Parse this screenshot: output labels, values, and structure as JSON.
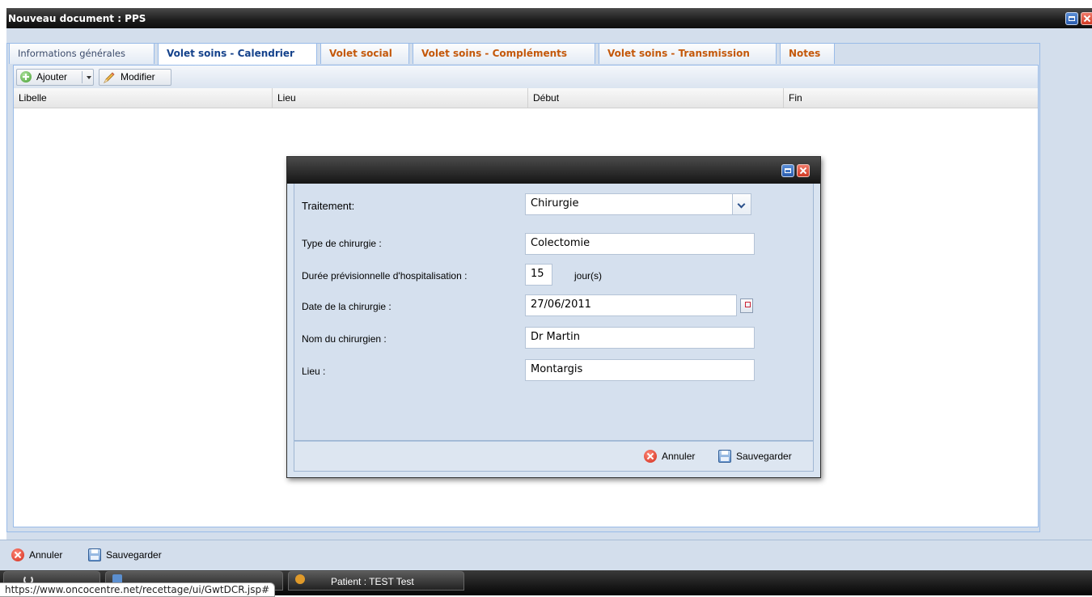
{
  "window": {
    "title": "Nouveau document : PPS"
  },
  "tabs": [
    {
      "label": "Informations générales"
    },
    {
      "label": "Volet soins - Calendrier"
    },
    {
      "label": "Volet social"
    },
    {
      "label": "Volet soins - Compléments"
    },
    {
      "label": "Volet soins - Transmission"
    },
    {
      "label": "Notes"
    }
  ],
  "toolbar": {
    "add_label": "Ajouter",
    "edit_label": "Modifier"
  },
  "grid": {
    "columns": [
      "Libelle",
      "Lieu",
      "Début",
      "Fin"
    ]
  },
  "dialog": {
    "fields": {
      "traitement": {
        "label": "Traitement:",
        "value": "Chirurgie"
      },
      "type": {
        "label": "Type de chirurgie :",
        "value": "Colectomie"
      },
      "duree": {
        "label": "Durée prévisionnelle d'hospitalisation :",
        "value": "15",
        "unit": "jour(s)"
      },
      "date": {
        "label": "Date de la chirurgie :",
        "value": "27/06/2011"
      },
      "chirurgien": {
        "label": "Nom du chirurgien :",
        "value": "Dr Martin"
      },
      "lieu": {
        "label": "Lieu :",
        "value": "Montargis"
      }
    },
    "cancel_label": "Annuler",
    "save_label": "Sauvegarder"
  },
  "footer": {
    "cancel_label": "Annuler",
    "save_label": "Sauvegarder"
  },
  "taskbar": {
    "patient_label": "Patient : TEST Test"
  },
  "statusbar": {
    "url": "https://www.oncocentre.net/recettage/ui/GwtDCR.jsp#"
  }
}
